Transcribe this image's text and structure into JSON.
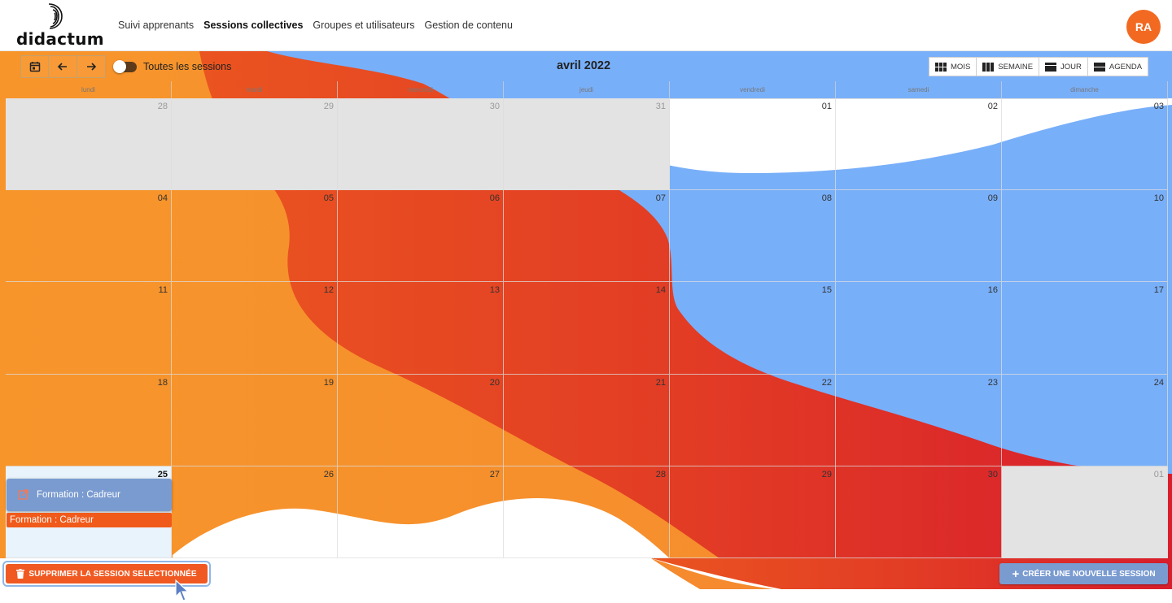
{
  "header": {
    "logo_text": "didactum",
    "nav": [
      {
        "label": "Suivi apprenants",
        "active": false
      },
      {
        "label": "Sessions collectives",
        "active": true
      },
      {
        "label": "Groupes et utilisateurs",
        "active": false
      },
      {
        "label": "Gestion de contenu",
        "active": false
      }
    ],
    "avatar_initials": "RA"
  },
  "toolbar": {
    "toggle_label": "Toutes les sessions",
    "title": "avril 2022",
    "views": [
      "MOIS",
      "SEMAINE",
      "JOUR",
      "AGENDA"
    ]
  },
  "calendar": {
    "weekdays": [
      "lundi",
      "mardi",
      "mercredi",
      "jeudi",
      "vendredi",
      "samedi",
      "dimanche"
    ],
    "weeks": [
      [
        {
          "n": "28",
          "off": true
        },
        {
          "n": "29",
          "off": true
        },
        {
          "n": "30",
          "off": true
        },
        {
          "n": "31",
          "off": true
        },
        {
          "n": "01"
        },
        {
          "n": "02"
        },
        {
          "n": "03"
        }
      ],
      [
        {
          "n": "04"
        },
        {
          "n": "05"
        },
        {
          "n": "06"
        },
        {
          "n": "07"
        },
        {
          "n": "08"
        },
        {
          "n": "09"
        },
        {
          "n": "10"
        }
      ],
      [
        {
          "n": "11"
        },
        {
          "n": "12"
        },
        {
          "n": "13"
        },
        {
          "n": "14"
        },
        {
          "n": "15"
        },
        {
          "n": "16"
        },
        {
          "n": "17"
        }
      ],
      [
        {
          "n": "18"
        },
        {
          "n": "19"
        },
        {
          "n": "20"
        },
        {
          "n": "21"
        },
        {
          "n": "22"
        },
        {
          "n": "23"
        },
        {
          "n": "24"
        }
      ],
      [
        {
          "n": "25",
          "today": true
        },
        {
          "n": "26"
        },
        {
          "n": "27"
        },
        {
          "n": "28"
        },
        {
          "n": "29"
        },
        {
          "n": "30"
        },
        {
          "n": "01",
          "off": true
        }
      ]
    ],
    "events": [
      {
        "label": "Formation : Cadreur",
        "style": "selected"
      },
      {
        "label": "Formation : Cadreur",
        "style": "default"
      }
    ]
  },
  "actions": {
    "delete_label": "SUPPRIMER LA SESSION SELECTIONNÉE",
    "create_label": "CRÉER UNE NOUVELLE SESSION"
  },
  "colors": {
    "accent_orange": "#f26a22",
    "event_blue": "#7a9bd0",
    "bg_blue": "#78aff9",
    "bg_red": "#e0322a"
  }
}
